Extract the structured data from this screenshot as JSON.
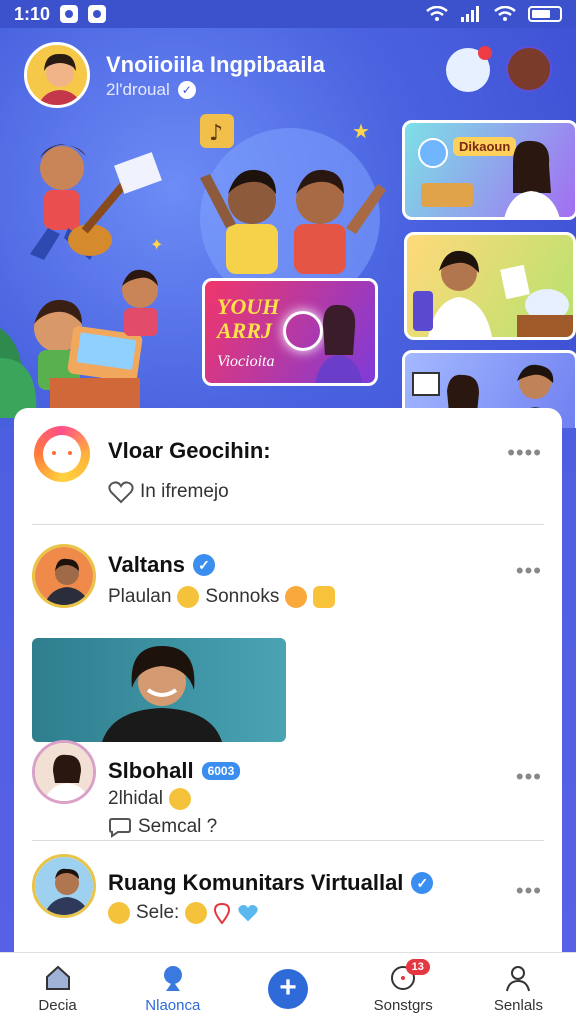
{
  "status_bar": {
    "time": "1:10"
  },
  "header": {
    "title": "Vnoiioiila Ingpibaaila",
    "subtitle": "2l'droual"
  },
  "banner_card": {
    "line1": "YOUH",
    "line2": "ARRJ",
    "line3": "Viocioita"
  },
  "side_card_top": {
    "label": "Dikaoun"
  },
  "feed": {
    "posts": [
      {
        "name": "Vloar Geocihin:",
        "sub": "In ifremejo"
      },
      {
        "name": "Valtans",
        "sub": "Plaulan",
        "sub2": "Sonnoks"
      },
      {
        "name": "Slbohall",
        "badge": "6003",
        "sub": "2lhidal",
        "sub2": "Semcal ?"
      },
      {
        "name": "Ruang Komunitars Virtuallal",
        "sub": "Sele:"
      }
    ]
  },
  "nav": {
    "items": [
      {
        "label": "Decia"
      },
      {
        "label": "Nlaonca"
      },
      {
        "label": ""
      },
      {
        "label": "Sonstgrs",
        "badge": "13"
      },
      {
        "label": "Senlals"
      }
    ]
  },
  "colors": {
    "accent": "#2f6ad9",
    "verified": "#3a8ef0",
    "badge": "#e5373f"
  }
}
